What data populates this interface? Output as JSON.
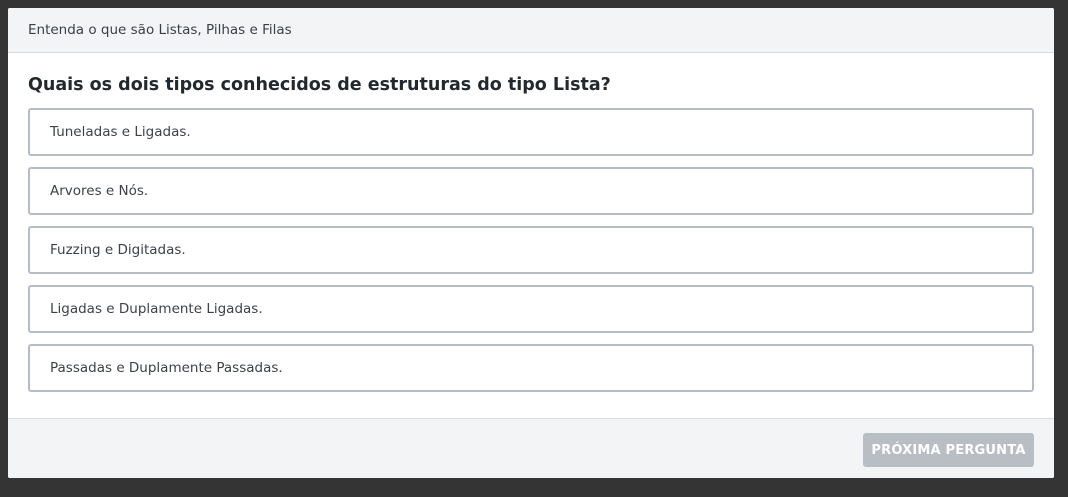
{
  "header": {
    "title": "Entenda o que são Listas, Pilhas e Filas"
  },
  "question": {
    "text": "Quais os dois tipos conhecidos de estruturas do tipo Lista?",
    "options": [
      {
        "label": "Tuneladas e Ligadas."
      },
      {
        "label": "Arvores e Nós."
      },
      {
        "label": "Fuzzing e Digitadas."
      },
      {
        "label": "Ligadas e Duplamente Ligadas."
      },
      {
        "label": "Passadas e Duplamente Passadas."
      }
    ]
  },
  "footer": {
    "next_label": "PRÓXIMA PERGUNTA"
  },
  "colors": {
    "backdrop": "#343434",
    "header_bg": "#f3f4f6",
    "option_border": "#b6bcc4",
    "button_disabled_bg": "#b9bec5"
  }
}
